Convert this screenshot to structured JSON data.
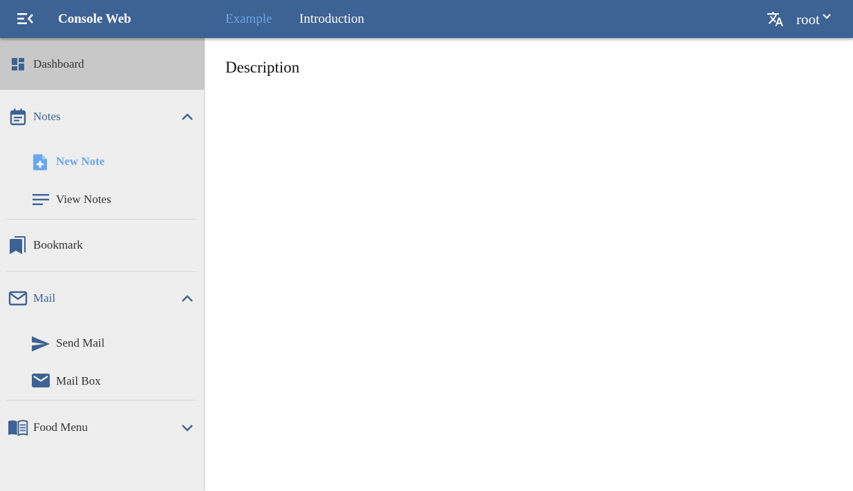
{
  "header": {
    "app_title": "Console Web",
    "tabs": [
      {
        "label": "Example",
        "active": true
      },
      {
        "label": "Introduction",
        "active": false
      }
    ],
    "user_name": "root",
    "icons": {
      "menu": "menu-collapse-icon",
      "language": "translate-icon",
      "user_dropdown": "chevron-down-icon"
    }
  },
  "sidebar": {
    "items": [
      {
        "label": "Dashboard",
        "icon": "dashboard-icon",
        "selected": true
      },
      {
        "label": "Notes",
        "icon": "calendar-note-icon",
        "expanded": true
      },
      {
        "label": "New Note",
        "icon": "note-add-icon",
        "active": true
      },
      {
        "label": "View Notes",
        "icon": "list-lines-icon"
      },
      {
        "label": "Bookmark",
        "icon": "bookmark-icon"
      },
      {
        "label": "Mail",
        "icon": "mail-outline-icon",
        "expanded": true
      },
      {
        "label": "Send Mail",
        "icon": "send-icon"
      },
      {
        "label": "Mail Box",
        "icon": "mail-icon"
      },
      {
        "label": "Food Menu",
        "icon": "menu-book-icon",
        "expanded": false
      }
    ]
  },
  "main": {
    "heading": "Description"
  },
  "colors": {
    "header_bg": "#3d6294",
    "accent": "#6aa6ec",
    "sidebar_bg": "#eeeeee",
    "selected_bg": "#c8c8c8",
    "icon_blue": "#3d6294"
  }
}
